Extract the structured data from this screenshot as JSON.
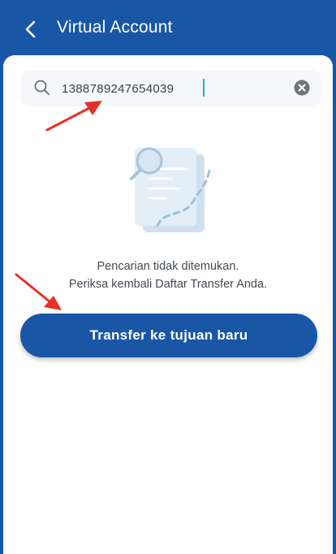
{
  "header": {
    "title": "Virtual Account",
    "back_icon": "chevron-left-icon"
  },
  "search": {
    "value": "1388789247654039",
    "icon": "search-icon",
    "clear_icon": "clear-icon"
  },
  "empty_state": {
    "illustration": "document-search-illustration",
    "line1": "Pencarian tidak ditemukan.",
    "line2": "Periksa kembali Daftar Transfer Anda."
  },
  "cta": {
    "label": "Transfer ke tujuan baru"
  },
  "colors": {
    "brand": "#1957a6",
    "annotation_arrow": "#e8302a"
  }
}
